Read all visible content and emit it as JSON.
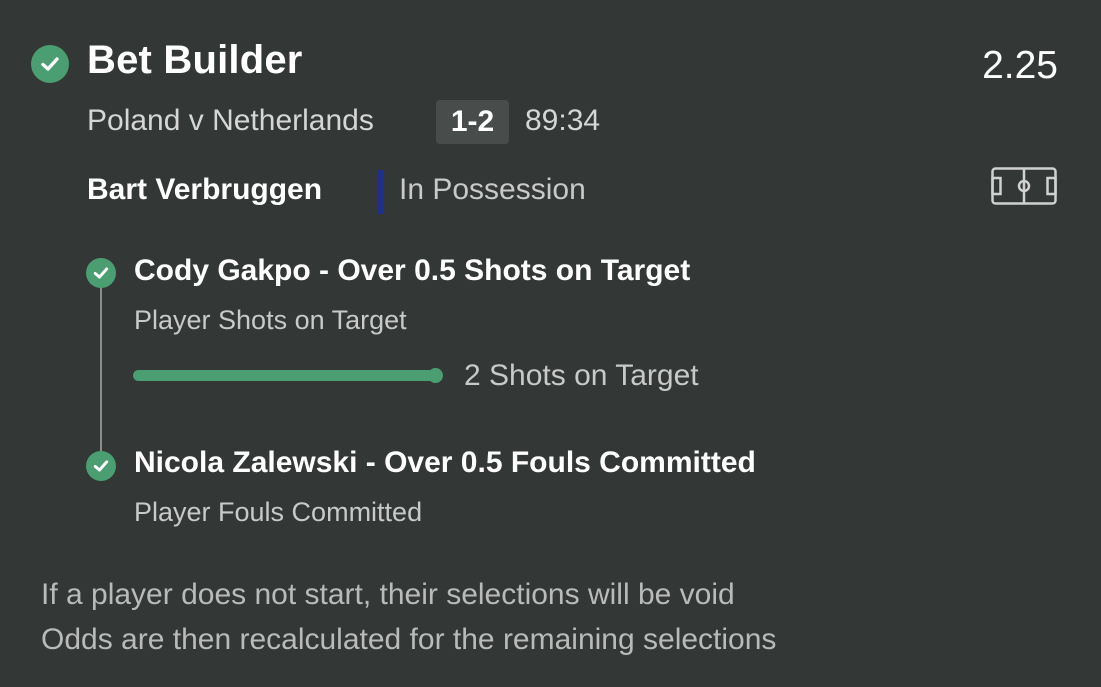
{
  "header": {
    "title": "Bet Builder",
    "odds": "2.25",
    "status_icon": "check-circle-icon"
  },
  "match": {
    "teams": "Poland v Netherlands",
    "score": "1-2",
    "clock": "89:34"
  },
  "possession": {
    "player": "Bart Verbruggen",
    "status": "In Possession",
    "team_color": "#1f2f8c",
    "pitch_icon": "pitch-icon"
  },
  "selections": [
    {
      "title": "Cody Gakpo - Over 0.5 Shots on Target",
      "market": "Player Shots on Target",
      "progress": {
        "fraction": 1.0,
        "label": "2 Shots on Target"
      },
      "status": "won"
    },
    {
      "title": "Nicola Zalewski - Over 0.5 Fouls Committed",
      "market": "Player Fouls Committed",
      "status": "won"
    }
  ],
  "notes": [
    "If a player does not start, their selections will be void",
    "Odds are then recalculated for the remaining selections"
  ],
  "colors": {
    "background": "#333836",
    "accent_green": "#4a9e72"
  }
}
